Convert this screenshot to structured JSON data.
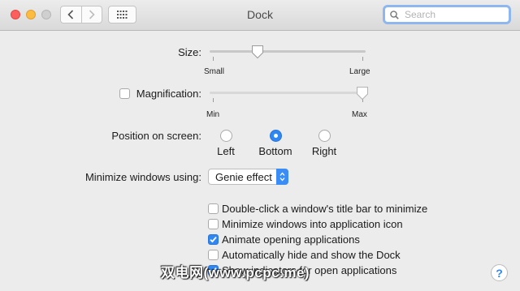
{
  "window": {
    "title": "Dock"
  },
  "search": {
    "placeholder": "Search"
  },
  "size": {
    "label": "Size:",
    "min_label": "Small",
    "max_label": "Large",
    "value": 0.3
  },
  "magnification": {
    "label": "Magnification:",
    "checked": false,
    "min_label": "Min",
    "max_label": "Max",
    "value": 1.0
  },
  "position": {
    "label": "Position on screen:",
    "options": [
      {
        "label": "Left",
        "selected": false
      },
      {
        "label": "Bottom",
        "selected": true
      },
      {
        "label": "Right",
        "selected": false
      }
    ]
  },
  "minimize": {
    "label": "Minimize windows using:",
    "selected": "Genie effect"
  },
  "checkboxes": [
    {
      "label": "Double-click a window's title bar to minimize",
      "checked": false
    },
    {
      "label": "Minimize windows into application icon",
      "checked": false
    },
    {
      "label": "Animate opening applications",
      "checked": true
    },
    {
      "label": "Automatically hide and show the Dock",
      "checked": false
    },
    {
      "label": "Show indicators for open applications",
      "checked": true
    }
  ],
  "help": {
    "glyph": "?"
  },
  "watermark": {
    "text": "双电网(www.pcpc.me)"
  },
  "colors": {
    "accent": "#2f87f4",
    "search_focus": "#8fb6ee"
  }
}
